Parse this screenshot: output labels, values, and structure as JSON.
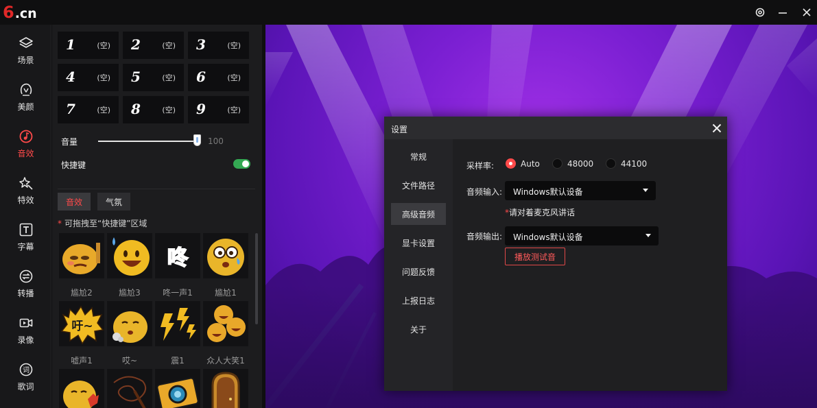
{
  "app": {
    "logo_main": "6",
    "logo_suffix": ".cn",
    "settings_icon": "gear-icon",
    "minimize_icon": "minimize-icon",
    "close_icon": "close-icon"
  },
  "nav": {
    "items": [
      {
        "label": "场景",
        "icon": "layers-icon",
        "active": false
      },
      {
        "label": "美颜",
        "icon": "face-icon",
        "active": false
      },
      {
        "label": "音效",
        "icon": "music-note-icon",
        "active": true
      },
      {
        "label": "特效",
        "icon": "sparkle-icon",
        "active": false
      },
      {
        "label": "字幕",
        "icon": "text-icon",
        "active": false
      },
      {
        "label": "转播",
        "icon": "relay-icon",
        "active": false
      },
      {
        "label": "录像",
        "icon": "video-record-icon",
        "active": false
      },
      {
        "label": "歌词",
        "icon": "lyrics-icon",
        "active": false
      }
    ],
    "accent": "#ff4a4a"
  },
  "panel": {
    "hotkeys": [
      {
        "num": "1",
        "state": "(空)"
      },
      {
        "num": "2",
        "state": "(空)"
      },
      {
        "num": "3",
        "state": "(空)"
      },
      {
        "num": "4",
        "state": "(空)"
      },
      {
        "num": "5",
        "state": "(空)"
      },
      {
        "num": "6",
        "state": "(空)"
      },
      {
        "num": "7",
        "state": "(空)"
      },
      {
        "num": "8",
        "state": "(空)"
      },
      {
        "num": "9",
        "state": "(空)"
      }
    ],
    "volume_label": "音量",
    "volume_value": 100,
    "volume_value_text": "100",
    "hotkey_label": "快捷键",
    "hotkey_enabled": true,
    "tabs": [
      {
        "label": "音效",
        "active": true
      },
      {
        "label": "气氛",
        "active": false
      }
    ],
    "hint_star": "*",
    "hint_text": "可拖拽至“快捷键”区域",
    "stickers": [
      {
        "name": "尴尬2",
        "icon": "awkward-face-icon"
      },
      {
        "name": "尴尬3",
        "icon": "sweat-smile-icon"
      },
      {
        "name": "咚一声1",
        "icon": "dong-text-icon"
      },
      {
        "name": "尴尬1",
        "icon": "dizzy-face-icon"
      },
      {
        "name": "嘘声1",
        "icon": "boo-text-icon"
      },
      {
        "name": "哎~",
        "icon": "sigh-face-icon"
      },
      {
        "name": "震1",
        "icon": "lightning-icon"
      },
      {
        "name": "众人大笑1",
        "icon": "laughing-crowd-icon"
      },
      {
        "name": "",
        "icon": "shy-face-icon"
      },
      {
        "name": "",
        "icon": "whip-icon"
      },
      {
        "name": "",
        "icon": "camera-icon"
      },
      {
        "name": "",
        "icon": "door-icon"
      }
    ],
    "toggle_color": "#34a853"
  },
  "dialog": {
    "title": "设置",
    "close_icon": "close-icon",
    "menu": [
      {
        "label": "常规",
        "active": false
      },
      {
        "label": "文件路径",
        "active": false
      },
      {
        "label": "高级音频",
        "active": true
      },
      {
        "label": "显卡设置",
        "active": false
      },
      {
        "label": "问题反馈",
        "active": false
      },
      {
        "label": "上报日志",
        "active": false
      },
      {
        "label": "关于",
        "active": false
      }
    ],
    "sample_rate_label": "采样率:",
    "sample_rates": [
      {
        "label": "Auto",
        "selected": true
      },
      {
        "label": "48000",
        "selected": false
      },
      {
        "label": "44100",
        "selected": false
      }
    ],
    "audio_in_label": "音频输入:",
    "audio_in_value": "Windows默认设备",
    "mic_note_star": "*",
    "mic_note": "请对着麦克风讲话",
    "audio_out_label": "音频输出:",
    "audio_out_value": "Windows默认设备",
    "test_button": "播放测试音"
  }
}
